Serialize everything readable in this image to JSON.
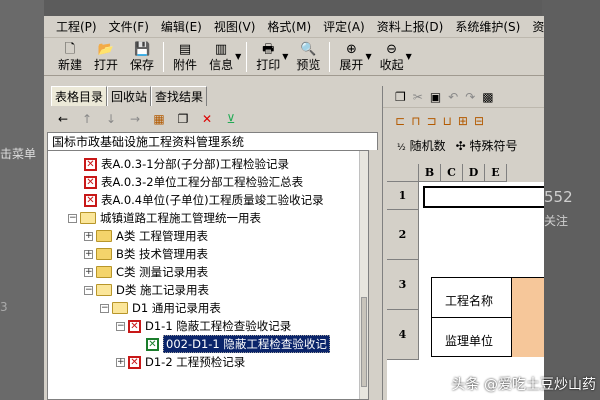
{
  "background": {
    "left_text_1": "击菜单",
    "left_text_2": "3",
    "right_number": "552",
    "right_text": "关注"
  },
  "menu": [
    "工程(P)",
    "文件(F)",
    "编辑(E)",
    "视图(V)",
    "格式(M)",
    "评定(A)",
    "资料上报(D)",
    "系统维护(S)",
    "资料"
  ],
  "toolbar": {
    "new": "新建",
    "open": "打开",
    "save": "保存",
    "attach": "附件",
    "info": "信息",
    "print": "打印",
    "preview": "预览",
    "expand": "展开",
    "collapse": "收起"
  },
  "left_tabs": [
    "表格目录",
    "回收站",
    "查找结果"
  ],
  "tree_root": "国标市政基础设施工程资料管理系统",
  "tree": [
    {
      "label": "表A.0.3-1分部(子分部)工程检验记录",
      "icon": "red-doc"
    },
    {
      "label": "表A.0.3-2单位工程分部工程检验汇总表",
      "icon": "red-doc"
    },
    {
      "label": "表A.0.4单位(子单位)工程质量竣工验收记录",
      "icon": "red-doc"
    },
    {
      "label": "城镇道路工程施工管理统一用表",
      "icon": "folder-open"
    },
    {
      "label": "A类 工程管理用表",
      "icon": "folder"
    },
    {
      "label": "B类 技术管理用表",
      "icon": "folder"
    },
    {
      "label": "C类 测量记录用表",
      "icon": "folder"
    },
    {
      "label": "D类 施工记录用表",
      "icon": "folder-open"
    },
    {
      "label": "D1 通用记录用表",
      "icon": "folder-open"
    },
    {
      "label": "D1-1 隐蔽工程检查验收记录",
      "icon": "red-doc"
    },
    {
      "label": "002-D1-1 隐蔽工程检查验收记",
      "icon": "green-doc"
    },
    {
      "label": "D1-2 工程预检记录",
      "icon": "red-doc"
    }
  ],
  "right_toolbar": {
    "random": "随机数",
    "special": "特殊符号"
  },
  "grid": {
    "columns": [
      "B",
      "C",
      "D",
      "E"
    ],
    "rows": [
      "1",
      "2",
      "3",
      "4"
    ],
    "labels": {
      "project_name": "工程名称",
      "supervisor": "监理单位"
    }
  },
  "watermark": "头条 @爱吃土豆炒山药"
}
